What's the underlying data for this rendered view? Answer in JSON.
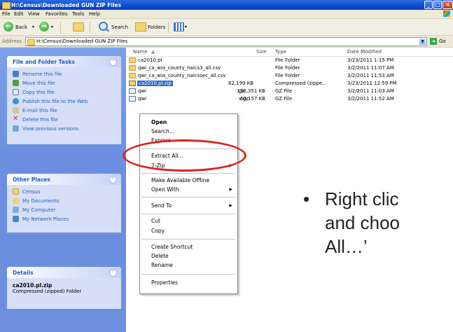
{
  "window": {
    "title": "H:\\Census\\Downloaded GUN ZIP Files",
    "controls": {
      "minimize": "_",
      "maximize": "□",
      "close": "×"
    }
  },
  "menubar": [
    "File",
    "Edit",
    "View",
    "Favorites",
    "Tools",
    "Help"
  ],
  "toolbar": {
    "back": "Back",
    "search": "Search",
    "folders": "Folders"
  },
  "address": {
    "label": "Address",
    "path": "H:\\Census\\Downloaded GUN ZIP Files",
    "go": "Go"
  },
  "file_tasks": {
    "title": "File and Folder Tasks",
    "items": [
      {
        "label": "Rename this file",
        "icon": "rename-icon"
      },
      {
        "label": "Move this file",
        "icon": "move-icon"
      },
      {
        "label": "Copy this file",
        "icon": "copy-icon"
      },
      {
        "label": "Publish this file to the Web",
        "icon": "publish-icon"
      },
      {
        "label": "E-mail this file",
        "icon": "email-icon"
      },
      {
        "label": "Delete this file",
        "icon": "delete-icon"
      },
      {
        "label": "View previous versions",
        "icon": "versions-icon"
      }
    ]
  },
  "other_places": {
    "title": "Other Places",
    "items": [
      {
        "label": "Census",
        "icon": "folder-icon"
      },
      {
        "label": "My Documents",
        "icon": "documents-icon"
      },
      {
        "label": "My Computer",
        "icon": "computer-icon"
      },
      {
        "label": "My Network Places",
        "icon": "network-icon"
      }
    ]
  },
  "details": {
    "title": "Details",
    "name": "ca2010.pl.zip",
    "type": "Compressed (zipped) Folder"
  },
  "columns": {
    "name": "Name",
    "size": "Size",
    "type": "Type",
    "modified": "Date Modified"
  },
  "files": [
    {
      "name": "ca2010.pl",
      "size": "",
      "type": "File Folder",
      "modified": "3/23/2011 1:15 PM",
      "kind": "folder"
    },
    {
      "name": "qwi_ca_wia_county_naics3_all.csv",
      "size": "",
      "type": "File Folder",
      "modified": "3/2/2011 11:07 AM",
      "kind": "folder"
    },
    {
      "name": "qwi_ca_wia_county_naicssec_all.csv",
      "size": "",
      "type": "File Folder",
      "modified": "3/2/2011 11:53 AM",
      "kind": "folder"
    },
    {
      "name": "ca2010.pl.zip",
      "size": "82,199 KB",
      "type": "Compressed (zippe...",
      "modified": "3/23/2011 12:59 PM",
      "kind": "zip"
    },
    {
      "name": "qwi",
      "name_tail": "gz",
      "size": "136,351 KB",
      "type": "GZ File",
      "modified": "3/2/2011 11:03 AM",
      "kind": "file"
    },
    {
      "name": "qwi",
      "name_tail": "v.gz",
      "size": "60,157 KB",
      "type": "GZ File",
      "modified": "3/2/2011 11:52 AM",
      "kind": "file"
    }
  ],
  "context_menu": [
    {
      "label": "Open",
      "bold": true
    },
    {
      "label": "Search..."
    },
    {
      "label": "Explore"
    },
    {
      "sep": true
    },
    {
      "label": "Extract All..."
    },
    {
      "label": "7-Zip",
      "submenu": true
    },
    {
      "sep": true
    },
    {
      "label": "Make Available Offline"
    },
    {
      "label": "Open With",
      "submenu": true
    },
    {
      "sep": true
    },
    {
      "label": "Send To",
      "submenu": true
    },
    {
      "sep": true
    },
    {
      "label": "Cut"
    },
    {
      "label": "Copy"
    },
    {
      "sep": true
    },
    {
      "label": "Create Shortcut"
    },
    {
      "label": "Delete"
    },
    {
      "label": "Rename"
    },
    {
      "sep": true
    },
    {
      "label": "Properties"
    }
  ],
  "slide": {
    "lines": [
      "Right clic",
      "and choo",
      "All…’"
    ]
  },
  "colors": {
    "highlight": "#e02020",
    "selection": "#316ac5",
    "taskpane": "#6d8fde"
  }
}
